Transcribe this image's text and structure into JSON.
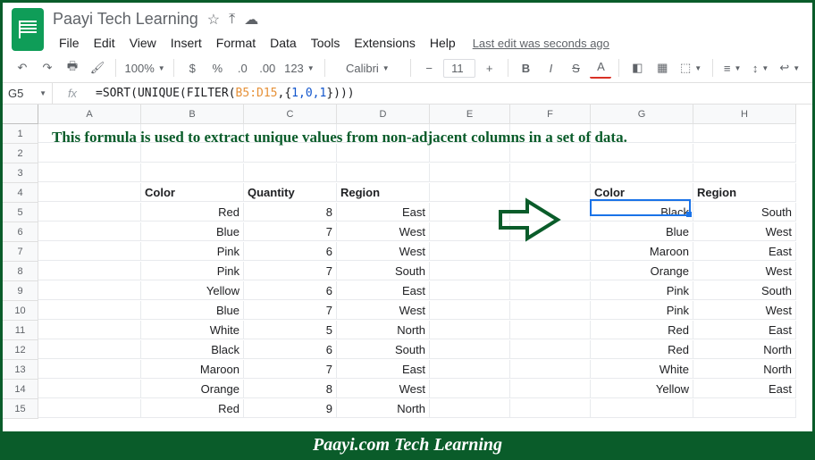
{
  "header": {
    "doc_title": "Paayi Tech Learning",
    "star_icon": "☆",
    "move_icon": "⤒",
    "cloud_icon": "☁",
    "last_edit": "Last edit was seconds ago"
  },
  "menu": {
    "file": "File",
    "edit": "Edit",
    "view": "View",
    "insert": "Insert",
    "format": "Format",
    "data": "Data",
    "tools": "Tools",
    "extensions": "Extensions",
    "help": "Help"
  },
  "toolbar": {
    "zoom": "100%",
    "currency": "$",
    "percent": "%",
    "dec_dec": ".0←",
    "inc_dec": ".00→",
    "num_fmt": "123",
    "font": "Calibri",
    "font_size": "11",
    "bold": "B",
    "italic": "I",
    "strike": "S",
    "text_color": "A"
  },
  "formula": {
    "name_box": "G5",
    "fx": "fx",
    "prefix": "=SORT(UNIQUE(FILTER(",
    "ref": "B5:D15",
    "mid": ",{",
    "arr": "1,0,1",
    "suffix": "})))"
  },
  "columns": [
    "A",
    "B",
    "C",
    "D",
    "E",
    "F",
    "G",
    "H"
  ],
  "row_numbers": [
    "1",
    "2",
    "3",
    "4",
    "5",
    "6",
    "7",
    "8",
    "9",
    "10",
    "11",
    "12",
    "13",
    "14",
    "15"
  ],
  "description": "This formula is used to extract unique values from non-adjacent columns in a set of data.",
  "left_headers": {
    "color": "Color",
    "quantity": "Quantity",
    "region": "Region"
  },
  "right_headers": {
    "color": "Color",
    "region": "Region"
  },
  "left_data": [
    {
      "color": "Red",
      "qty": "8",
      "region": "East"
    },
    {
      "color": "Blue",
      "qty": "7",
      "region": "West"
    },
    {
      "color": "Pink",
      "qty": "6",
      "region": "West"
    },
    {
      "color": "Pink",
      "qty": "7",
      "region": "South"
    },
    {
      "color": "Yellow",
      "qty": "6",
      "region": "East"
    },
    {
      "color": "Blue",
      "qty": "7",
      "region": "West"
    },
    {
      "color": "White",
      "qty": "5",
      "region": "North"
    },
    {
      "color": "Black",
      "qty": "6",
      "region": "South"
    },
    {
      "color": "Maroon",
      "qty": "7",
      "region": "East"
    },
    {
      "color": "Orange",
      "qty": "8",
      "region": "West"
    },
    {
      "color": "Red",
      "qty": "9",
      "region": "North"
    }
  ],
  "right_data": [
    {
      "color": "Black",
      "region": "South"
    },
    {
      "color": "Blue",
      "region": "West"
    },
    {
      "color": "Maroon",
      "region": "East"
    },
    {
      "color": "Orange",
      "region": "West"
    },
    {
      "color": "Pink",
      "region": "South"
    },
    {
      "color": "Pink",
      "region": "West"
    },
    {
      "color": "Red",
      "region": "East"
    },
    {
      "color": "Red",
      "region": "North"
    },
    {
      "color": "White",
      "region": "North"
    },
    {
      "color": "Yellow",
      "region": "East"
    }
  ],
  "footer": "Paayi.com Tech Learning"
}
